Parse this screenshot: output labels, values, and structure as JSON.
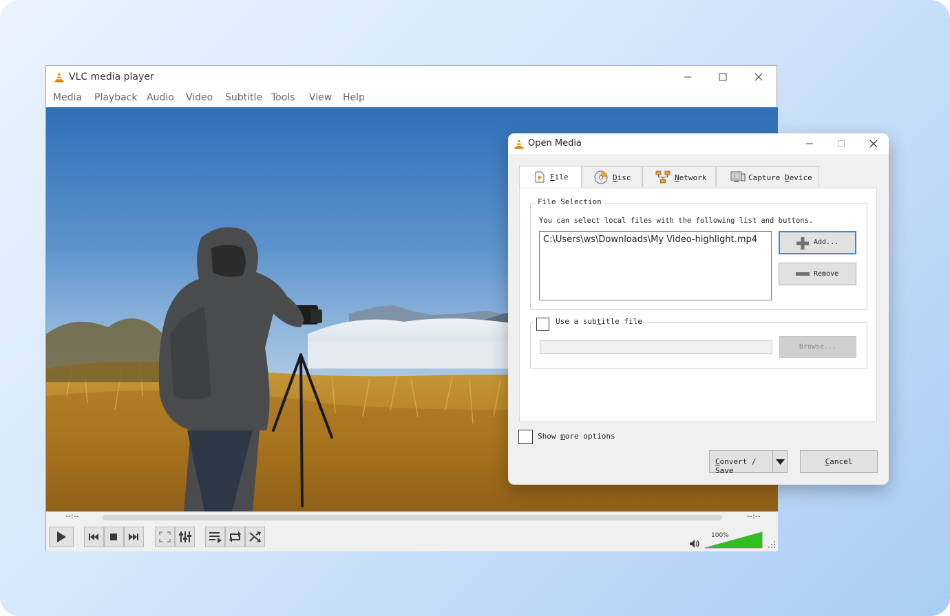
{
  "vlc": {
    "title": "VLC media player",
    "menu": [
      "Media",
      "Playback",
      "Audio",
      "Video",
      "Subtitle",
      "Tools",
      "View",
      "Help"
    ],
    "time_elapsed": "--:--",
    "time_total": "--:--",
    "volume": "100%",
    "volume_level": 1.0
  },
  "dialog": {
    "title": "Open Media",
    "tabs": {
      "file": {
        "pre": "",
        "key": "F",
        "post": "ile"
      },
      "disc": {
        "pre": "",
        "key": "D",
        "post": "isc"
      },
      "network": {
        "pre": "",
        "key": "N",
        "post": "etwork"
      },
      "capture": {
        "pre": "Capture ",
        "key": "D",
        "post": "evice"
      }
    },
    "file_selection": {
      "legend": "File Selection",
      "description": "You can select local files with the following list and buttons.",
      "files": [
        "C:\\Users\\ws\\Downloads\\My Video-highlight.mp4"
      ],
      "add_label": "Add...",
      "remove_label": "Remove"
    },
    "subtitle": {
      "pre": "Use a sub",
      "key": "t",
      "post": "itle file",
      "path_value": "",
      "browse_label": "Browse..."
    },
    "show_more": {
      "pre": "Show ",
      "key": "m",
      "post": "ore options"
    },
    "convert": {
      "key": "C",
      "post": "onvert / Save"
    },
    "cancel": {
      "key": "C",
      "post": "ancel"
    }
  },
  "colors": {
    "accent": "#3b87d8",
    "vlc_orange": "#f08a00",
    "volume_green": "#2fbf1f"
  },
  "icons": [
    "vlc-cone-icon",
    "minimize-icon",
    "maximize-icon",
    "close-icon",
    "play-icon",
    "previous-icon",
    "stop-icon",
    "next-icon",
    "fullscreen-icon",
    "extended-settings-icon",
    "playlist-icon",
    "loop-icon",
    "shuffle-icon",
    "speaker-icon",
    "file-icon",
    "disc-icon",
    "network-icon",
    "capture-device-icon",
    "plus-icon",
    "minus-icon",
    "dropdown-arrow-icon"
  ]
}
